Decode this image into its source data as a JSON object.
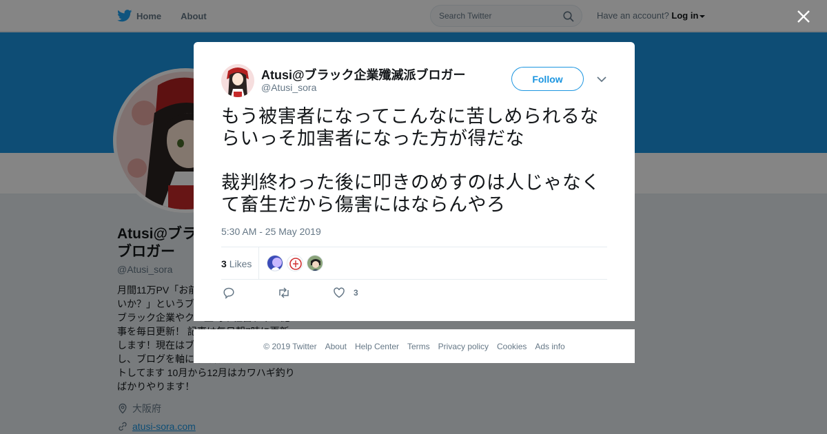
{
  "topnav": {
    "home_label": "Home",
    "about_label": "About",
    "search_placeholder": "Search Twitter",
    "account_text": "Have an account?",
    "login_label": "Log in"
  },
  "profile": {
    "name": "Atusi@ブラック企業殲滅派ブロガー",
    "handle": "@Atusi_sora",
    "bio": "月間11万PV「お前の会社ブラックじゃないか？」というブログを運営してます。ブラック企業やクソ上司や社畜ディス記事を毎日更新！ 記事は毎日朝7時に更新します！現在はブラック社畜から脱出し、ブログを軸に不労働所得でネオニートしてます 10月から12月はカワハギ釣りばかりやります！",
    "location": "大阪府",
    "website": "atusi-sora.com"
  },
  "tweet": {
    "author_name": "Atusi@ブラック企業殲滅派ブロガー",
    "author_handle": "@Atusi_sora",
    "follow_label": "Follow",
    "text_para1": "もう被害者になってこんなに苦しめられるならいっそ加害者になった方が得だな",
    "text_para2": "裁判終わった後に叩きのめすのは人じゃなくて畜生だから傷害にはならんやろ",
    "timestamp": "5:30 AM - 25 May 2019",
    "likes_count": "3",
    "likes_label": "Likes",
    "like_action_count": "3"
  },
  "footer": {
    "links": [
      "© 2019 Twitter",
      "About",
      "Help Center",
      "Terms",
      "Privacy policy",
      "Cookies",
      "Ads info"
    ]
  },
  "colors": {
    "brand": "#1b95e0",
    "text": "#14171a",
    "secondary": "#657786",
    "overlay": "rgba(0,0,0,0.48)"
  },
  "icons": [
    "twitter-bird-icon",
    "search-icon",
    "close-icon",
    "chevron-down-icon",
    "reply-icon",
    "retweet-icon",
    "heart-icon",
    "location-icon",
    "link-icon"
  ]
}
